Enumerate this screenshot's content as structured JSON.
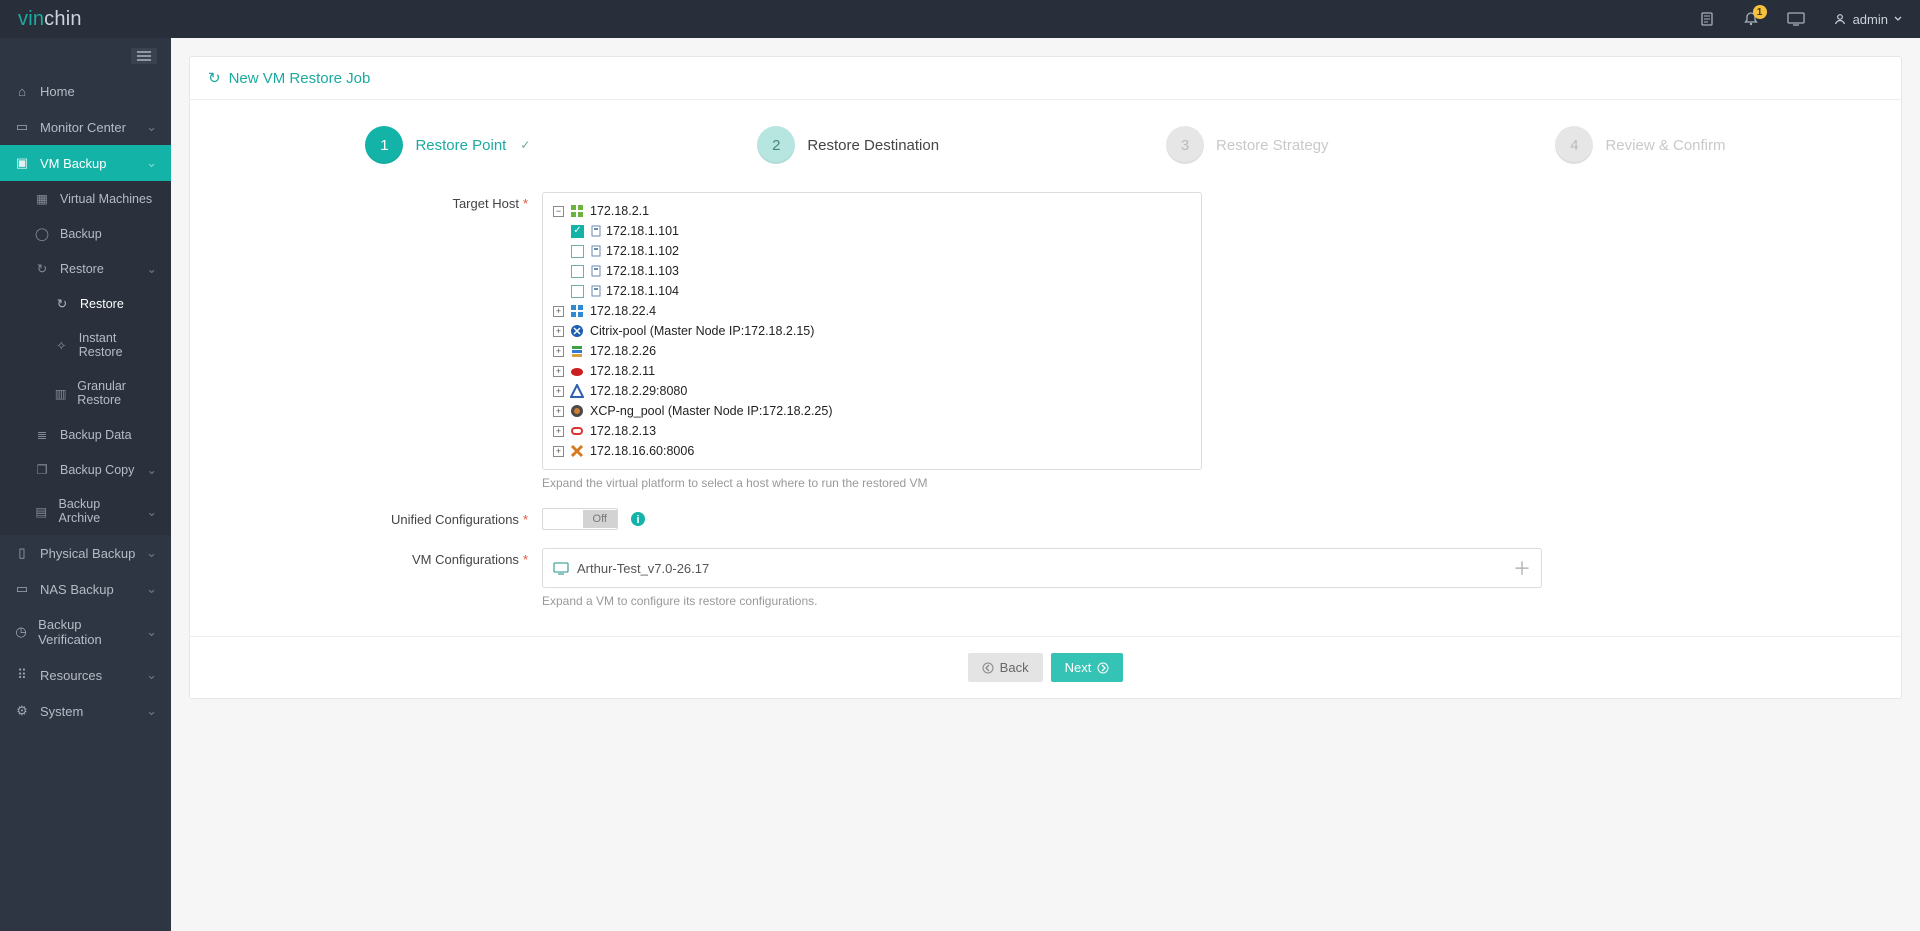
{
  "brand": "vinchin",
  "header": {
    "notify_count": "1",
    "user_label": "admin"
  },
  "sidebar": {
    "items": [
      {
        "label": "Home",
        "icon": "home"
      },
      {
        "label": "Monitor Center",
        "icon": "monitor",
        "expandable": true
      },
      {
        "label": "VM Backup",
        "icon": "vm",
        "expandable": true,
        "active": true,
        "children": [
          {
            "label": "Virtual Machines",
            "icon": "grid"
          },
          {
            "label": "Backup",
            "icon": "circle"
          },
          {
            "label": "Restore",
            "icon": "refresh",
            "expandable": true,
            "open": true,
            "children": [
              {
                "label": "Restore",
                "icon": "refresh",
                "sel": true
              },
              {
                "label": "Instant Restore",
                "icon": "flash"
              },
              {
                "label": "Granular Restore",
                "icon": "grid2"
              }
            ]
          },
          {
            "label": "Backup Data",
            "icon": "db"
          },
          {
            "label": "Backup Copy",
            "icon": "copy",
            "expandable": true
          },
          {
            "label": "Backup Archive",
            "icon": "archive",
            "expandable": true
          }
        ]
      },
      {
        "label": "Physical Backup",
        "icon": "server",
        "expandable": true
      },
      {
        "label": "NAS Backup",
        "icon": "nas",
        "expandable": true
      },
      {
        "label": "Backup Verification",
        "icon": "clock",
        "expandable": true
      },
      {
        "label": "Resources",
        "icon": "dots",
        "expandable": true
      },
      {
        "label": "System",
        "icon": "gear",
        "expandable": true
      }
    ]
  },
  "page": {
    "title": "New VM Restore Job",
    "steps": [
      {
        "num": "1",
        "label": "Restore Point",
        "state": "done"
      },
      {
        "num": "2",
        "label": "Restore Destination",
        "state": "current"
      },
      {
        "num": "3",
        "label": "Restore Strategy",
        "state": "upcoming"
      },
      {
        "num": "4",
        "label": "Review & Confirm",
        "state": "upcoming"
      }
    ],
    "form": {
      "target_host_label": "Target Host",
      "target_host_help": "Expand the virtual platform to select a host where to run the restored VM",
      "unified_label": "Unified Configurations",
      "unified_value": "Off",
      "vmconf_label": "VM Configurations",
      "vmconf_value": "Arthur-Test_v7.0-26.17",
      "vmconf_help": "Expand a VM to configure its restore configurations."
    },
    "tree": {
      "root": {
        "label": "172.18.2.1",
        "children": [
          {
            "label": "172.18.1.101",
            "checked": true
          },
          {
            "label": "172.18.1.102",
            "checked": false
          },
          {
            "label": "172.18.1.103",
            "checked": false
          },
          {
            "label": "172.18.1.104",
            "checked": false
          }
        ]
      },
      "sibs": [
        {
          "label": "172.18.22.4",
          "icon": "windows"
        },
        {
          "label": "Citrix-pool (Master Node IP:172.18.2.15)",
          "icon": "citrix"
        },
        {
          "label": "172.18.2.26",
          "icon": "stack"
        },
        {
          "label": "172.18.2.11",
          "icon": "redhat"
        },
        {
          "label": "172.18.2.29:8080",
          "icon": "tri"
        },
        {
          "label": "XCP-ng_pool (Master Node IP:172.18.2.25)",
          "icon": "xcp"
        },
        {
          "label": "172.18.2.13",
          "icon": "oracle"
        },
        {
          "label": "172.18.16.60:8006",
          "icon": "x"
        }
      ]
    },
    "actions": {
      "back": "Back",
      "next": "Next"
    }
  }
}
